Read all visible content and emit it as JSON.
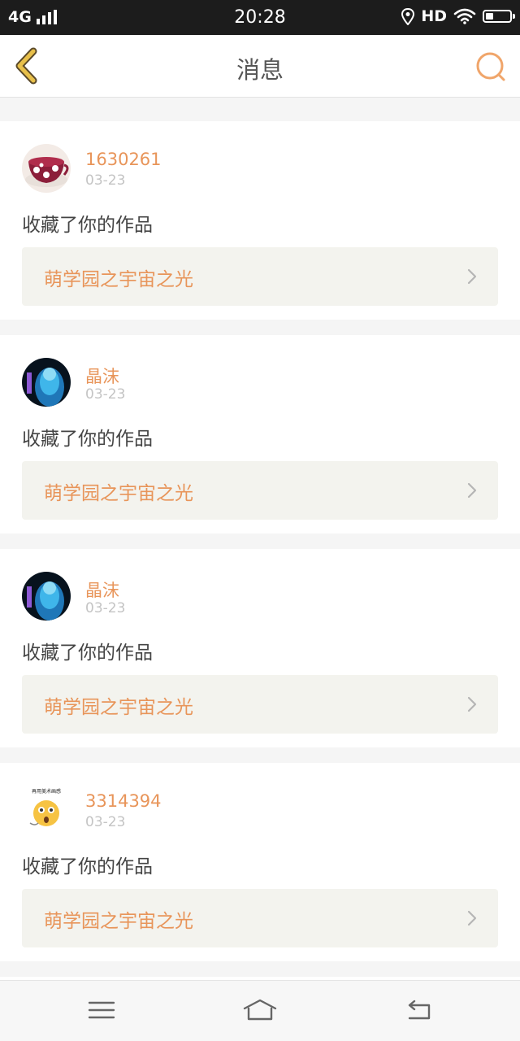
{
  "status_bar": {
    "network": "4G",
    "time": "20:28",
    "hd": "HD"
  },
  "header": {
    "title": "消息",
    "back_icon": "chevron-left-icon",
    "search_icon": "search-icon"
  },
  "colors": {
    "accent": "#e8955a",
    "back_icon": "#d7a628"
  },
  "messages": [
    {
      "user": "1630261",
      "date": "03-23",
      "action": "收藏了你的作品",
      "work": "萌学园之宇宙之光",
      "avatar": "teacup-avatar"
    },
    {
      "user": "晶沫",
      "date": "03-23",
      "action": "收藏了你的作品",
      "work": "萌学园之宇宙之光",
      "avatar": "anime-avatar"
    },
    {
      "user": "晶沫",
      "date": "03-23",
      "action": "收藏了你的作品",
      "work": "萌学园之宇宙之光",
      "avatar": "anime-avatar"
    },
    {
      "user": "3314394",
      "date": "03-23",
      "action": "收藏了你的作品",
      "work": "萌学园之宇宙之光",
      "avatar": "emoji-avatar",
      "avatar_caption": "再用美术画感"
    }
  ],
  "nav_bar": {
    "menu_icon": "menu-icon",
    "home_icon": "home-icon",
    "back_icon": "return-icon"
  }
}
